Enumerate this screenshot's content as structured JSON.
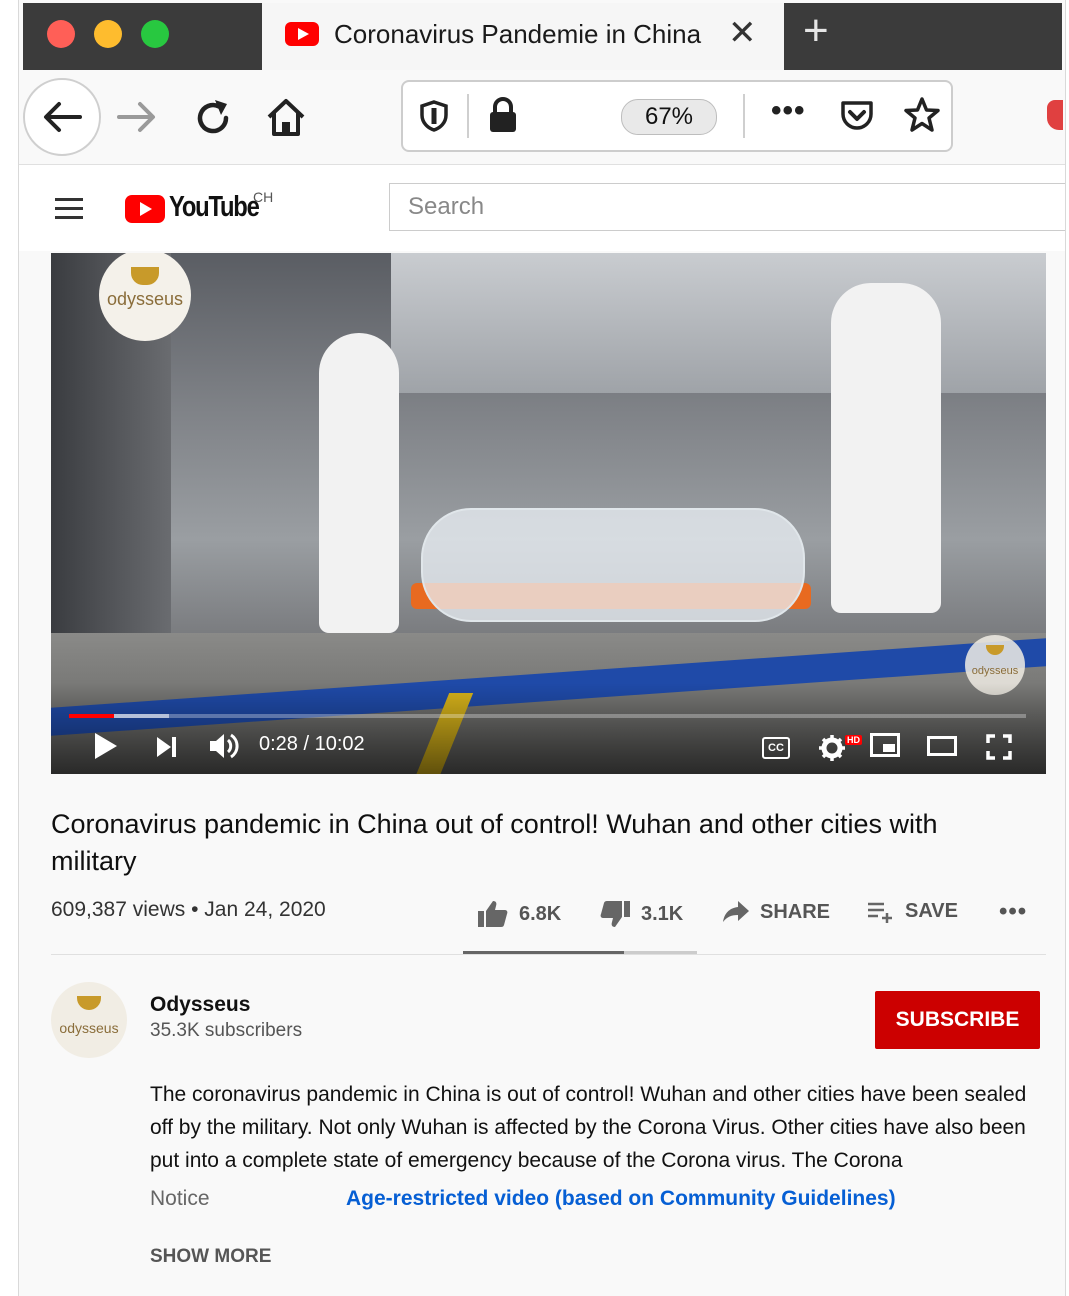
{
  "browser": {
    "tab_title": "Coronavirus Pandemie in China",
    "zoom_level": "67%",
    "traffic_colors": {
      "close": "#ff5f57",
      "minimize": "#febc2e",
      "maximize": "#28c840"
    }
  },
  "youtube": {
    "wordmark": "YouTube",
    "country": "CH",
    "search_placeholder": "Search"
  },
  "player": {
    "time": "0:28 / 10:02",
    "progress_fraction": 0.047,
    "buffered_fraction": 0.105,
    "quality_badge": "HD",
    "watermark": "odysseus"
  },
  "video": {
    "title": "Coronavirus pandemic in China out of control! Wuhan and other cities with military",
    "views": "609,387 views",
    "date": "Jan 24, 2020",
    "likes": "6.8K",
    "dislikes": "3.1K",
    "share_label": "SHARE",
    "save_label": "SAVE",
    "like_fraction": 0.687
  },
  "channel": {
    "name": "Odysseus",
    "subscribers": "35.3K subscribers",
    "avatar_text": "odysseus",
    "subscribe_label": "SUBSCRIBE"
  },
  "description": {
    "text": "The coronavirus pandemic in China is out of control! Wuhan and other cities have been sealed off by the military. Not only Wuhan is affected by the Corona Virus. Other cities have also been put into a complete state of emergency because of the Corona virus. The Corona",
    "notice_label": "Notice",
    "notice_link": "Age-restricted video (based on Community Guidelines)",
    "show_more": "SHOW MORE"
  }
}
